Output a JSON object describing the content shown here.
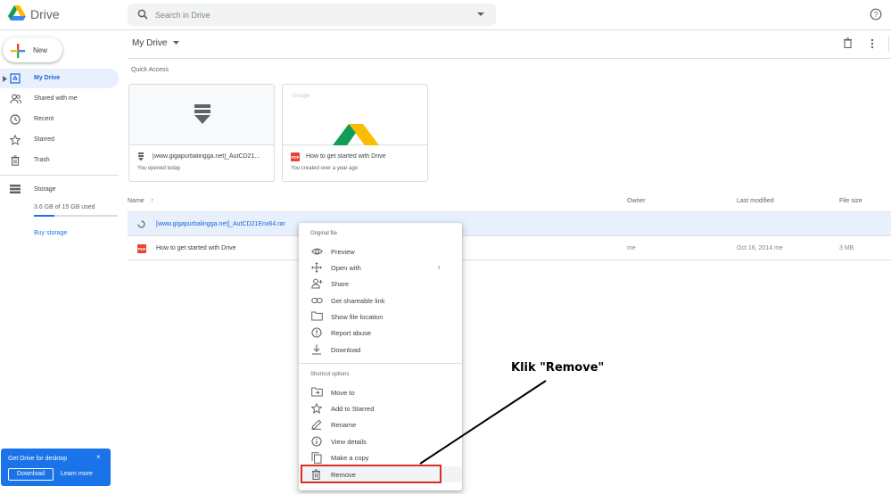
{
  "header": {
    "app_name": "Drive",
    "search_placeholder": "Search in Drive"
  },
  "sidebar": {
    "new_label": "New",
    "items": [
      {
        "label": "My Drive",
        "icon": "my-drive-icon",
        "active": true
      },
      {
        "label": "Shared with me",
        "icon": "people-icon"
      },
      {
        "label": "Recent",
        "icon": "clock-icon"
      },
      {
        "label": "Starred",
        "icon": "star-icon"
      },
      {
        "label": "Trash",
        "icon": "trash-icon"
      }
    ],
    "storage": {
      "label": "Storage",
      "usage_text": "3.6 GB of 15 GB used",
      "used_fraction": 0.24,
      "buy_label": "Buy storage"
    }
  },
  "promo": {
    "title": "Get Drive for desktop",
    "close": "×",
    "download_label": "Download",
    "learn_label": "Learn more"
  },
  "main": {
    "title": "My Drive",
    "quick_access_label": "Quick Access",
    "cards": [
      {
        "name": "[www.gigapurbalingga.net]_AutCD21...",
        "subtitle": "You opened today"
      },
      {
        "name": "How to get started with Drive",
        "subtitle": "You created over a year ago",
        "thumb_text": "Google"
      }
    ],
    "columns": {
      "name": "Name",
      "sort_arrow": "↑",
      "owner": "Owner",
      "modified": "Last modified",
      "size": "File size"
    },
    "rows": [
      {
        "name": "[www.gigapurbalingga.net]_AutCD21Enx64.rar",
        "owner": "",
        "modified": "",
        "size": "",
        "selected": true
      },
      {
        "name": "How to get started with Drive",
        "owner": "me",
        "modified": "Oct 16, 2014 me",
        "size": "3 MB",
        "selected": false
      }
    ]
  },
  "context_menu": {
    "section1": "Original file",
    "items1": [
      {
        "label": "Preview",
        "icon": "eye-icon"
      },
      {
        "label": "Open with",
        "icon": "move-arrows-icon",
        "submenu": true
      },
      {
        "label": "Share",
        "icon": "person-add-icon"
      },
      {
        "label": "Get shareable link",
        "icon": "link-icon"
      },
      {
        "label": "Show file location",
        "icon": "folder-icon"
      },
      {
        "label": "Report abuse",
        "icon": "alert-icon"
      },
      {
        "label": "Download",
        "icon": "download-icon"
      }
    ],
    "section2": "Shortcut options",
    "items2": [
      {
        "label": "Move to",
        "icon": "move-to-icon"
      },
      {
        "label": "Add to Starred",
        "icon": "star-icon"
      },
      {
        "label": "Rename",
        "icon": "pencil-icon"
      },
      {
        "label": "View details",
        "icon": "info-icon"
      },
      {
        "label": "Make a copy",
        "icon": "copy-icon"
      },
      {
        "label": "Remove",
        "icon": "trash-icon",
        "highlighted": true
      }
    ]
  },
  "annotation": {
    "text": "Klik \"Remove\"",
    "highlight_color": "#d93025"
  },
  "colors": {
    "accent": "#1a73e8",
    "selected_bg": "#e8f0fe",
    "pdf_red": "#ea4335"
  }
}
